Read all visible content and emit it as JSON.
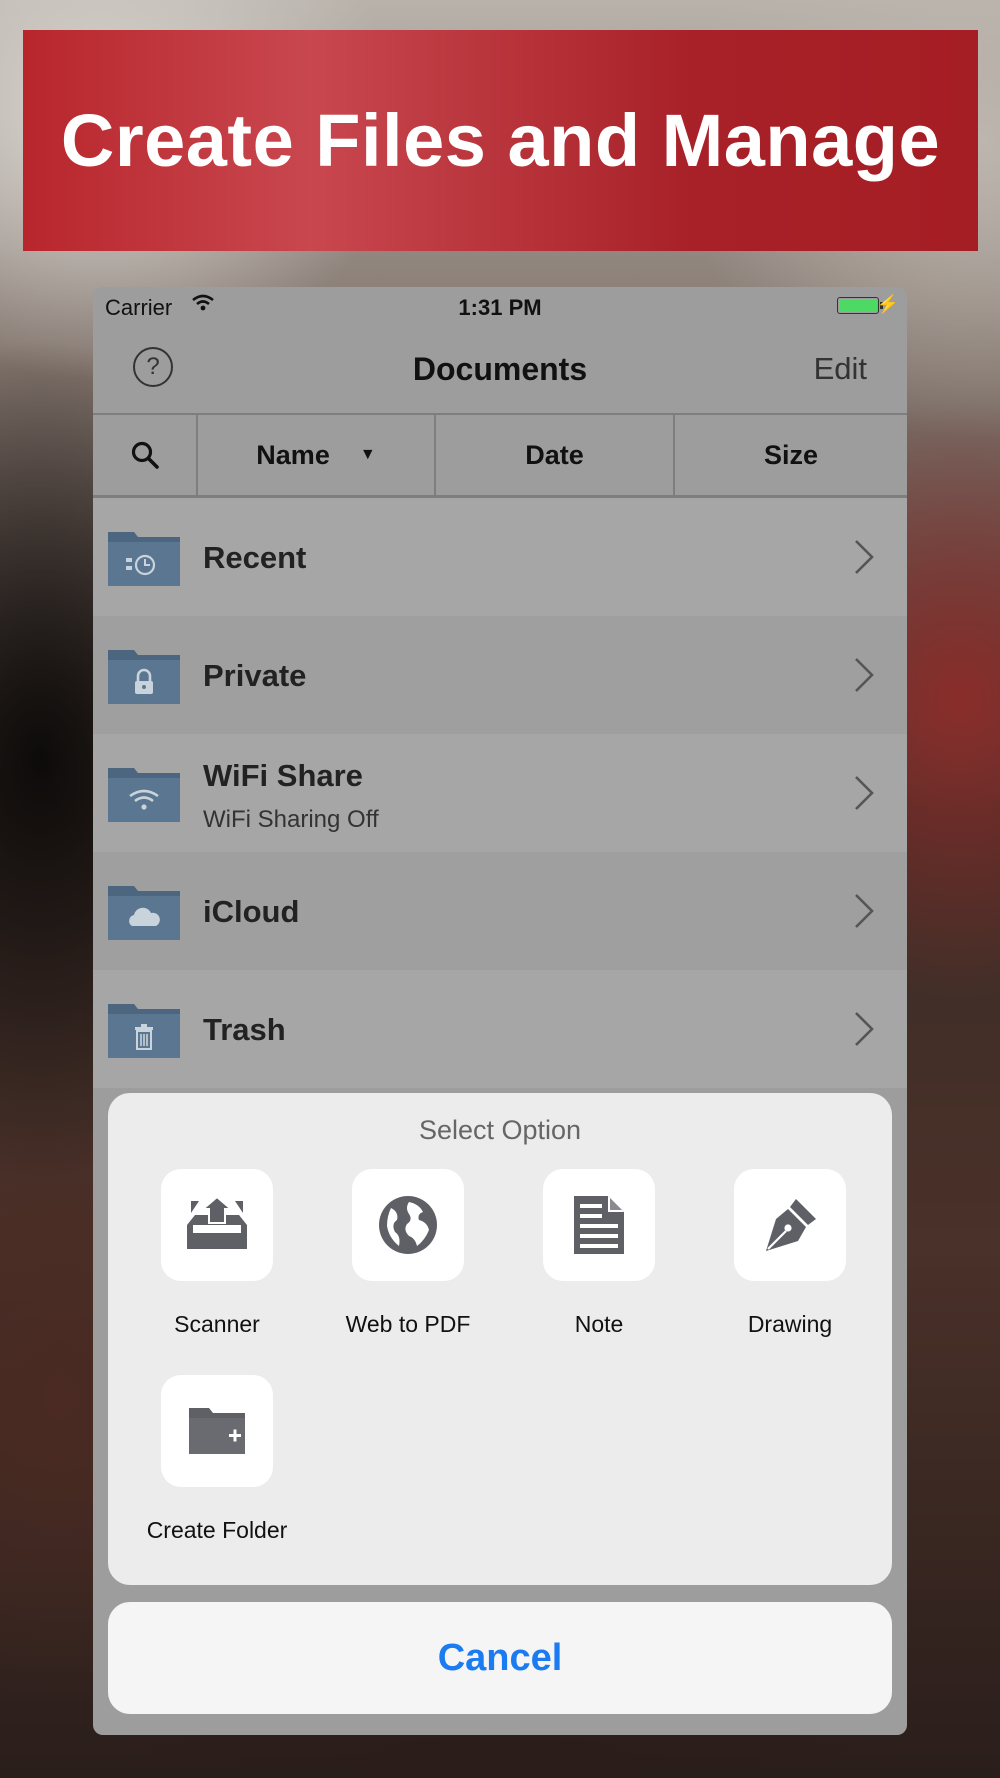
{
  "banner": {
    "title": "Create Files and Manage"
  },
  "status_bar": {
    "carrier": "Carrier",
    "time": "1:31 PM",
    "battery_color": "#4cd964"
  },
  "nav": {
    "help_label": "?",
    "title": "Documents",
    "edit_label": "Edit"
  },
  "sort": {
    "columns": [
      {
        "label": "Name",
        "indicator": "▼"
      },
      {
        "label": "Date"
      },
      {
        "label": "Size"
      }
    ]
  },
  "folders": [
    {
      "label": "Recent",
      "icon": "clock-icon"
    },
    {
      "label": "Private",
      "icon": "lock-icon"
    },
    {
      "label": "WiFi Share",
      "subtitle": "WiFi Sharing Off",
      "icon": "wifi-icon"
    },
    {
      "label": "iCloud",
      "icon": "cloud-icon"
    },
    {
      "label": "Trash",
      "icon": "trash-icon"
    }
  ],
  "sheet": {
    "title": "Select Option",
    "options": [
      {
        "label": "Scanner",
        "icon": "scanner-icon"
      },
      {
        "label": "Web to PDF",
        "icon": "globe-icon"
      },
      {
        "label": "Note",
        "icon": "note-icon"
      },
      {
        "label": "Drawing",
        "icon": "pen-nib-icon"
      },
      {
        "label": "Create Folder",
        "icon": "folder-plus-icon"
      }
    ],
    "cancel_label": "Cancel"
  },
  "colors": {
    "banner_red": "#b8262c",
    "folder_blue": "#4c6680",
    "icon_gray": "#5f5f66",
    "cancel_blue": "#1a7cf0"
  }
}
